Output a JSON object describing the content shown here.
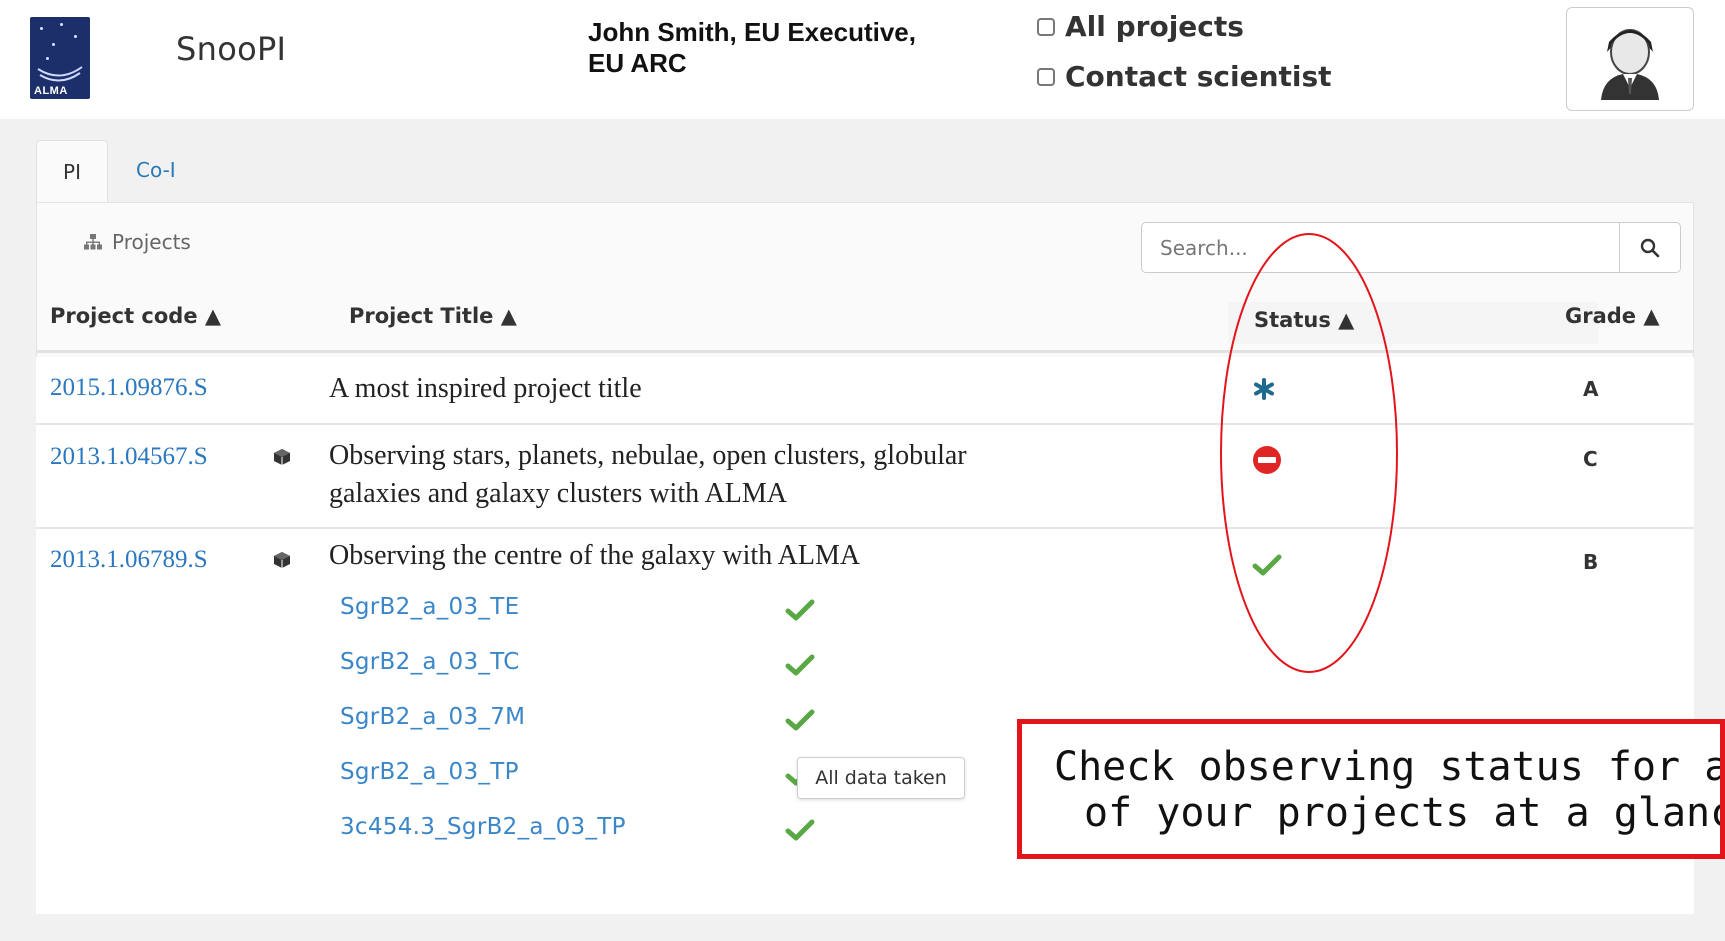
{
  "header": {
    "logo_text": "ALMA",
    "app_name": "SnooPI",
    "user_line1": "John Smith, EU Executive,",
    "user_line2": "EU ARC",
    "checkbox_all_projects": "All projects",
    "checkbox_contact_scientist": "Contact scientist"
  },
  "tabs": [
    {
      "label": "PI",
      "active": true
    },
    {
      "label": "Co-I",
      "active": false
    }
  ],
  "toolbar": {
    "projects_label": "Projects",
    "search_placeholder": "Search..."
  },
  "table": {
    "columns": [
      "Project code ▲",
      "Project Title ▲",
      "Status ▲",
      "Grade ▲"
    ],
    "rows": [
      {
        "code": "2015.1.09876.S",
        "title": "A most inspired project title",
        "status": "asterisk-icon",
        "grade": "A"
      },
      {
        "code": "2013.1.04567.S",
        "title_line1": "Observing stars, planets, nebulae, open clusters, globular",
        "title_line2": "galaxies and galaxy clusters with ALMA",
        "status": "no-entry-icon",
        "grade": "C"
      },
      {
        "code": "2013.1.06789.S",
        "title": "Observing the centre of the galaxy with ALMA",
        "status": "check-icon",
        "grade": "B",
        "schedblocks": [
          "SgrB2_a_03_TE",
          "SgrB2_a_03_TC",
          "SgrB2_a_03_7M",
          "SgrB2_a_03_TP",
          "3c454.3_SgrB2_a_03_TP"
        ]
      }
    ]
  },
  "tooltip": "All data taken",
  "callout": {
    "line1": "Check observing status for al",
    "line2": "of your projects at a glance"
  },
  "colors": {
    "link": "#2a78c0",
    "check_green": "#5aa845",
    "stop_red": "#e02525",
    "asterisk_blue": "#1f6a8f",
    "callout_border": "#e4141b"
  }
}
